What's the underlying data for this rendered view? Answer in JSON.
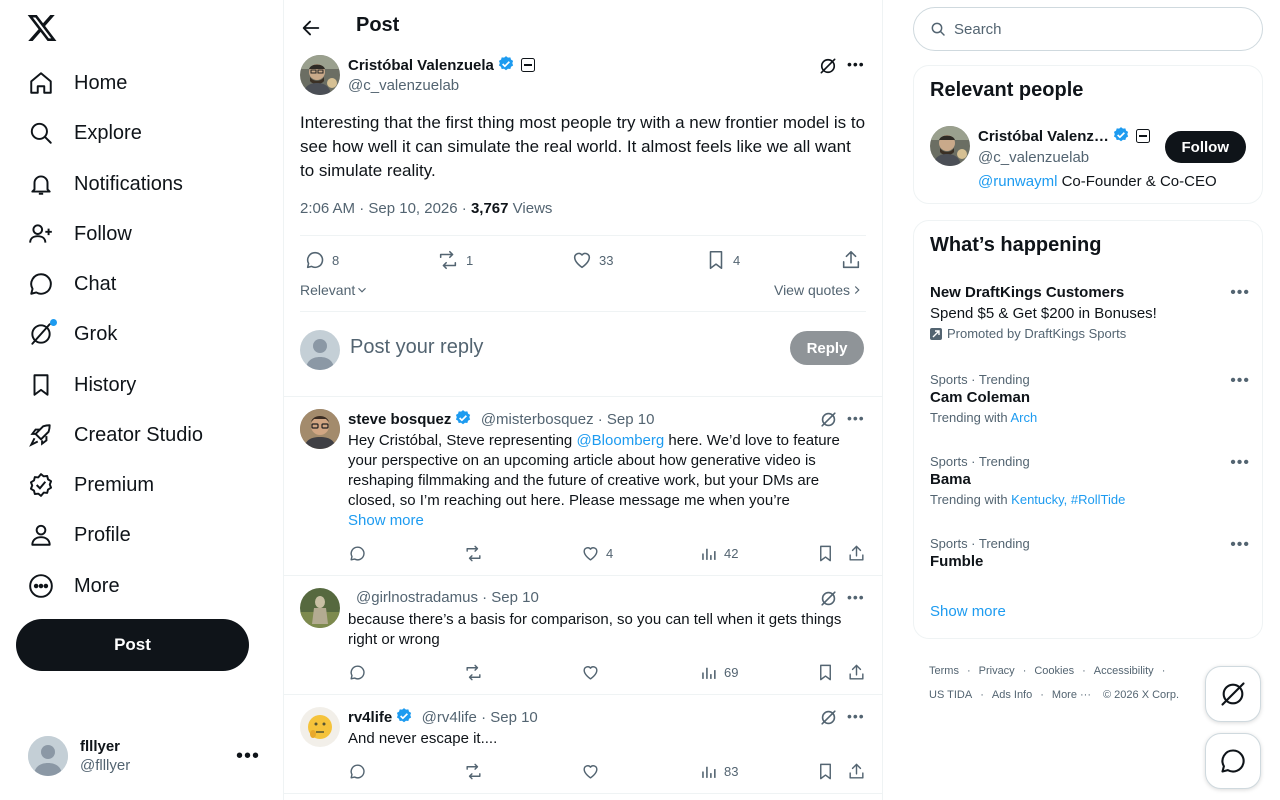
{
  "nav": {
    "items": [
      {
        "label": "Home",
        "icon": "home-icon"
      },
      {
        "label": "Explore",
        "icon": "search-icon"
      },
      {
        "label": "Notifications",
        "icon": "bell-icon"
      },
      {
        "label": "Follow",
        "icon": "add-person-icon"
      },
      {
        "label": "Chat",
        "icon": "chat-bubble-icon"
      },
      {
        "label": "Grok",
        "icon": "grok-icon"
      },
      {
        "label": "History",
        "icon": "bookmark-icon"
      },
      {
        "label": "Creator Studio",
        "icon": "rocket-icon"
      },
      {
        "label": "Premium",
        "icon": "verified-badge-icon"
      },
      {
        "label": "Profile",
        "icon": "person-icon"
      },
      {
        "label": "More",
        "icon": "more-circle-icon"
      }
    ],
    "post_label": "Post",
    "account": {
      "name": "flllyer",
      "handle": "@flllyer"
    }
  },
  "header": {
    "title": "Post"
  },
  "main_post": {
    "author": "Cristóbal Valenzuela",
    "handle": "@c_valenzuelab",
    "text": "Interesting that the first thing most people try with a new frontier model is to see how well it can simulate the real world. It almost feels like we all want to simulate reality.",
    "time": "2:06 AM · Sep 10, 2026 · ",
    "views_count": "3,767",
    "views_label": " Views",
    "replies": "8",
    "reposts": "1",
    "likes": "33",
    "bookmarks": "4",
    "sort_label": "Relevant",
    "quotes_label": "View quotes"
  },
  "reply_box": {
    "placeholder": "Post your reply",
    "button": "Reply"
  },
  "replies": [
    {
      "author": "steve bosquez",
      "handle": "@misterbosquez · Sep 10",
      "text_pre": "Hey Cristóbal, Steve representing ",
      "mention": "@Bloomberg",
      "text_post": " here. We’d love to feature your perspective on an upcoming article about how generative video is reshaping filmmaking and the future of creative work, but your DMs are closed, so I’m reaching out here. Please message me when you’re",
      "show_more": "Show more",
      "likes": "4",
      "views": "42"
    },
    {
      "author": "",
      "handle": "@girlnostradamus · Sep 10",
      "text": "because there’s a basis for comparison, so you can tell when it gets things right or wrong",
      "views": "69"
    },
    {
      "author": "rv4life",
      "handle": "@rv4life · Sep 10",
      "text": "And never escape it....",
      "views": "83"
    }
  ],
  "search": {
    "placeholder": "Search"
  },
  "relevant": {
    "title": "Relevant people",
    "name": "Cristóbal Valenz…",
    "handle": "@c_valenzuelab",
    "bio_link": "@runwayml",
    "bio_text": " Co-Founder & Co-CEO",
    "follow": "Follow"
  },
  "happening": {
    "title": "What’s happening",
    "ad": {
      "title": "New DraftKings Customers",
      "body": "Spend $5 & Get $200 in Bonuses!",
      "promo": "Promoted by DraftKings Sports"
    },
    "trends": [
      {
        "meta": "Sports · Trending",
        "title": "Cam Coleman",
        "with": "Trending with ",
        "tags": "Arch"
      },
      {
        "meta": "Sports · Trending",
        "title": "Bama",
        "with": "Trending with ",
        "tags": "Kentucky, #RollTide"
      },
      {
        "meta": "Sports · Trending",
        "title": "Fumble",
        "with": "",
        "tags": ""
      }
    ],
    "show_more": "Show more"
  },
  "footer": {
    "links": [
      "Terms",
      "Privacy",
      "Cookies",
      "Accessibility",
      "US TIDA",
      "Ads Info",
      "More ···"
    ],
    "copyright": "© 2026 X Corp."
  },
  "colors": {
    "accent": "#1d9bf0",
    "text": "#0f1419",
    "muted": "#536471",
    "border": "#eff3f4"
  }
}
